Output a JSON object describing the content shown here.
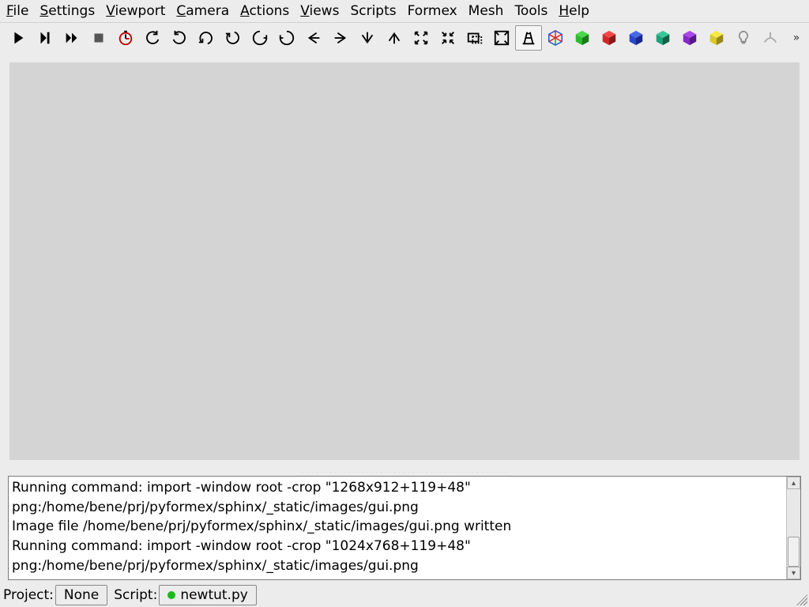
{
  "menubar": {
    "items": [
      {
        "label": "File",
        "u": true
      },
      {
        "label": "Settings",
        "u": true
      },
      {
        "label": "Viewport",
        "u": true
      },
      {
        "label": "Camera",
        "u": true
      },
      {
        "label": "Actions",
        "u": true
      },
      {
        "label": "Views",
        "u": true
      },
      {
        "label": "Scripts",
        "u": false
      },
      {
        "label": "Formex",
        "u": false
      },
      {
        "label": "Mesh",
        "u": false
      },
      {
        "label": "Tools",
        "u": false
      },
      {
        "label": "Help",
        "u": true
      }
    ]
  },
  "toolbar": {
    "buttons": [
      {
        "name": "play-icon",
        "kind": "play"
      },
      {
        "name": "step-icon",
        "kind": "step"
      },
      {
        "name": "fastforward-icon",
        "kind": "ff"
      },
      {
        "name": "stop-icon",
        "kind": "stop"
      },
      {
        "name": "timer-icon",
        "kind": "timer"
      },
      {
        "name": "rotate-left-icon",
        "kind": "rotl"
      },
      {
        "name": "rotate-right-icon",
        "kind": "rotr"
      },
      {
        "name": "rotate-up-icon",
        "kind": "rotu"
      },
      {
        "name": "rotate-down-icon",
        "kind": "rotd"
      },
      {
        "name": "twist-left-icon",
        "kind": "twl"
      },
      {
        "name": "twist-right-icon",
        "kind": "twr"
      },
      {
        "name": "arrow-left-icon",
        "kind": "al"
      },
      {
        "name": "arrow-right-icon",
        "kind": "ar"
      },
      {
        "name": "arrow-down-icon",
        "kind": "ad"
      },
      {
        "name": "arrow-up-icon",
        "kind": "au"
      },
      {
        "name": "zoom-out-icon",
        "kind": "zo"
      },
      {
        "name": "zoom-in-icon",
        "kind": "zi"
      },
      {
        "name": "zoom-rect-icon",
        "kind": "zr"
      },
      {
        "name": "zoom-all-icon",
        "kind": "za"
      },
      {
        "name": "perspective-icon",
        "kind": "persp",
        "active": true
      },
      {
        "name": "cube-wire-icon",
        "kind": "cw",
        "colors": [
          "#e02020",
          "#20a020",
          "#2050e0"
        ]
      },
      {
        "name": "cube-green-icon",
        "kind": "cube",
        "colors": [
          "#2fb82f",
          "#1a7a1a",
          "#48d848"
        ]
      },
      {
        "name": "cube-red-icon",
        "kind": "cube",
        "colors": [
          "#d02828",
          "#8a1818",
          "#f04848"
        ]
      },
      {
        "name": "cube-blue-icon",
        "kind": "cube",
        "colors": [
          "#2848c8",
          "#182888",
          "#4868e8"
        ]
      },
      {
        "name": "cube-teal-icon",
        "kind": "cube",
        "colors": [
          "#20a078",
          "#146048",
          "#38c898"
        ]
      },
      {
        "name": "cube-purple-icon",
        "kind": "cube",
        "colors": [
          "#8828c8",
          "#581888",
          "#a848e8"
        ]
      },
      {
        "name": "cube-yellow-icon",
        "kind": "cube",
        "colors": [
          "#d8c828",
          "#988818",
          "#f8e848"
        ]
      },
      {
        "name": "lightbulb-icon",
        "kind": "bulb"
      },
      {
        "name": "normals-icon",
        "kind": "normals"
      }
    ]
  },
  "console": {
    "lines": [
      "Running command: import -window root -crop \"1268x912+119+48\"",
      "png:/home/bene/prj/pyformex/sphinx/_static/images/gui.png",
      "Image file /home/bene/prj/pyformex/sphinx/_static/images/gui.png written",
      "Running command: import -window root -crop \"1024x768+119+48\"",
      "png:/home/bene/prj/pyformex/sphinx/_static/images/gui.png"
    ]
  },
  "statusbar": {
    "project_label": "Project:",
    "project_value": "None",
    "script_label": "Script:",
    "script_value": "newtut.py"
  }
}
